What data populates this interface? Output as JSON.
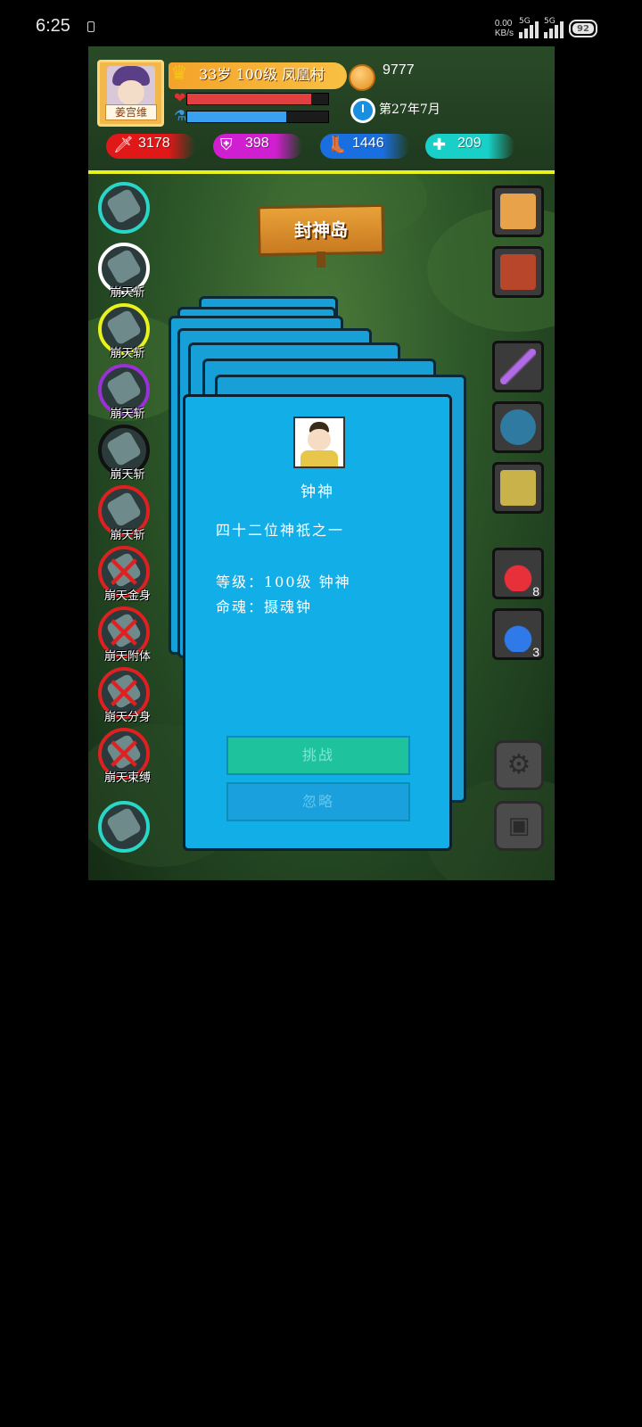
{
  "status_bar": {
    "time": "6:25",
    "net_speed_value": "0.00",
    "net_speed_unit": "KB/s",
    "signal1_label": "5G",
    "signal2_label": "5G",
    "battery": "92"
  },
  "hud": {
    "avatar_name": "姜宫维",
    "level_text": "33岁  100级  凤凰村",
    "gold": "9777",
    "hp_fraction": 0.88,
    "mp_fraction": 0.7,
    "date": "第27年7月",
    "stats": [
      {
        "icon": "sword-icon",
        "value": "3178",
        "color": "#e01818"
      },
      {
        "icon": "shield-icon",
        "value": "398",
        "color": "#d01fd0"
      },
      {
        "icon": "boot-icon",
        "value": "1446",
        "color": "#1a6fe0"
      },
      {
        "icon": "heart-plus-icon",
        "value": "209",
        "color": "#18d0c8"
      }
    ]
  },
  "location": "封神岛",
  "skills": [
    {
      "label": "",
      "ring": "#29d6c8",
      "locked": false
    },
    {
      "label": "崩天斩",
      "ring": "#ffffff",
      "locked": false
    },
    {
      "label": "崩天斩",
      "ring": "#e9f21a",
      "locked": false
    },
    {
      "label": "崩天斩",
      "ring": "#9b2fd8",
      "locked": false
    },
    {
      "label": "崩天斩",
      "ring": "#111111",
      "locked": false
    },
    {
      "label": "崩天斩",
      "ring": "#e02020",
      "locked": false
    },
    {
      "label": "崩天金身",
      "ring": "#e02020",
      "locked": true
    },
    {
      "label": "崩天附体",
      "ring": "#e02020",
      "locked": true
    },
    {
      "label": "崩天分身",
      "ring": "#e02020",
      "locked": true
    },
    {
      "label": "崩天束缚",
      "ring": "#e02020",
      "locked": true
    },
    {
      "label": "",
      "ring": "#29d6c8",
      "locked": false
    }
  ],
  "items": [
    {
      "name": "map-scroll-icon",
      "count": ""
    },
    {
      "name": "book-icon",
      "count": ""
    },
    {
      "name": "sword-item-icon",
      "count": ""
    },
    {
      "name": "armor-icon",
      "count": ""
    },
    {
      "name": "boots-icon",
      "count": ""
    },
    {
      "name": "red-potion-icon",
      "count": "8"
    },
    {
      "name": "blue-potion-icon",
      "count": "3"
    }
  ],
  "card": {
    "name": "钟神",
    "desc": "四十二位神祇之一",
    "level_line": "等级：100级 钟神",
    "soul_line": "命魂：摄魂钟",
    "challenge_label": "挑战",
    "ignore_label": "忽略"
  }
}
